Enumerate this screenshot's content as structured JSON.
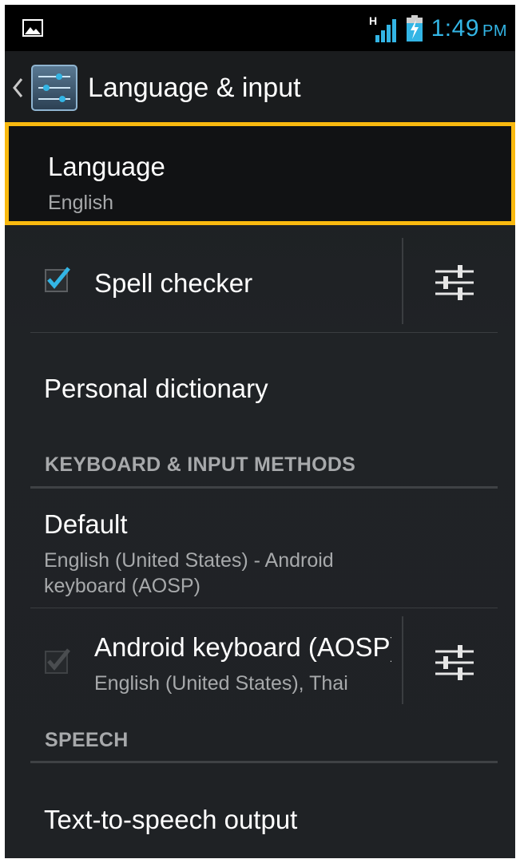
{
  "status_bar": {
    "time": "1:49",
    "ampm": "PM",
    "network_label": "H",
    "clock_color": "#33b5e5",
    "icons": [
      "picture-icon",
      "signal-icon",
      "battery-charging-icon"
    ]
  },
  "action_bar": {
    "title": "Language & input",
    "icons": [
      "back-chevron-icon",
      "settings-sliders-icon"
    ]
  },
  "items": {
    "language": {
      "title": "Language",
      "summary": "English"
    },
    "spell_checker": {
      "title": "Spell checker",
      "checked": true
    },
    "personal_dictionary": {
      "title": "Personal dictionary"
    },
    "default": {
      "title": "Default",
      "summary": "English (United States) - Android keyboard (AOSP)"
    },
    "android_keyboard": {
      "title": "Android keyboard (AOSP)",
      "summary": "English (United States), Thai",
      "checked": true,
      "disabled": true
    },
    "tts": {
      "title": "Text-to-speech output"
    }
  },
  "sections": {
    "keyboard": "KEYBOARD & INPUT METHODS",
    "speech": "SPEECH"
  },
  "colors": {
    "highlight": "#f9b90f",
    "accent": "#33b5e5",
    "background": "#1f2225"
  }
}
